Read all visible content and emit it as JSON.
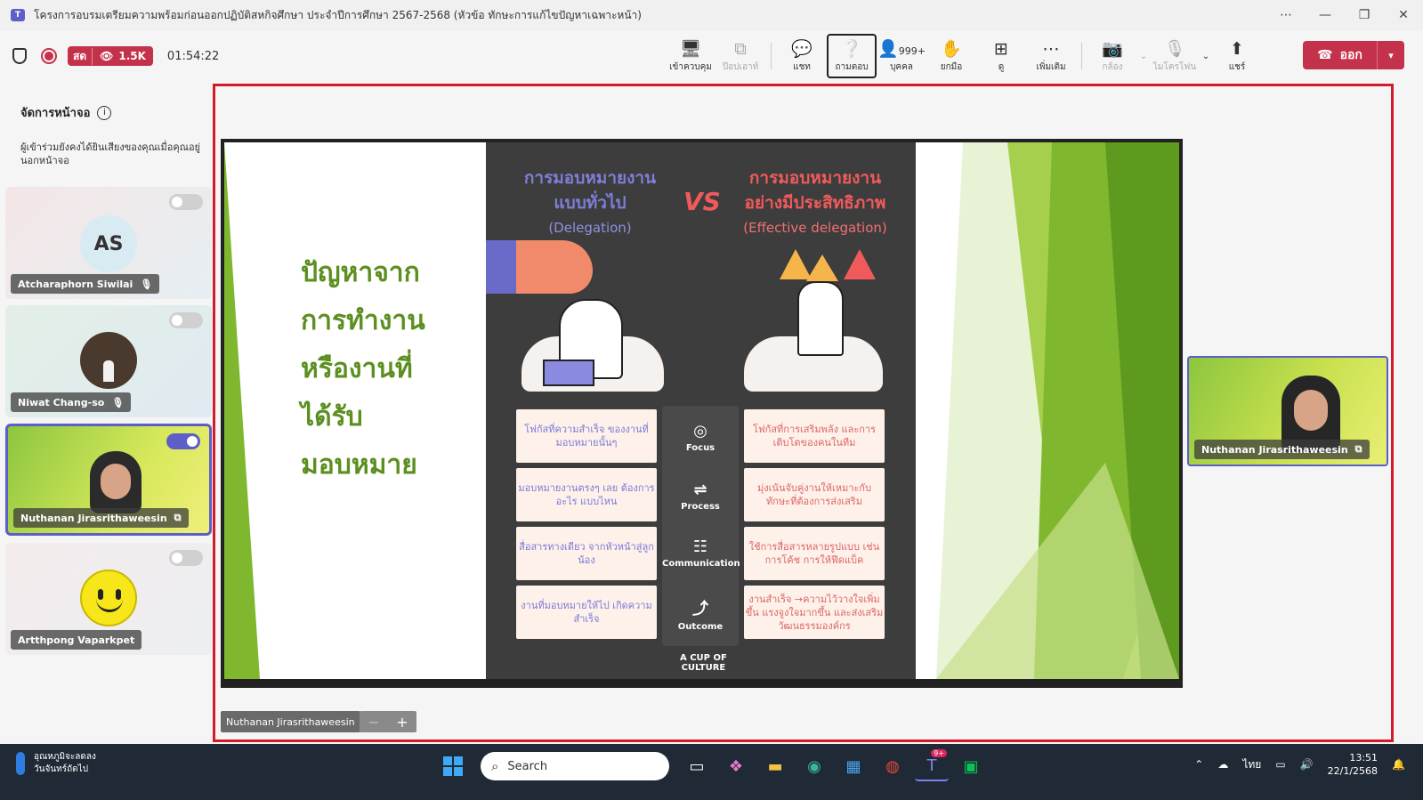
{
  "window": {
    "title": "โครงการอบรมเตรียมความพร้อมก่อนออกปฏิบัติสหกิจศึกษา ประจำปีการศึกษา 2567-2568 (หัวข้อ ทักษะการแก้ไขปัญหาเฉพาะหน้า)",
    "app_icon": "teams-icon"
  },
  "meeting": {
    "live_label": "สด",
    "viewers": "1.5K",
    "timer": "01:54:22",
    "tools": [
      {
        "label": "เข้าควบคุม",
        "icon": "take-control-icon"
      },
      {
        "label": "ป๊อปเอาท์",
        "icon": "popout-icon"
      },
      {
        "label": "แชท",
        "icon": "chat-icon"
      },
      {
        "label": "ถามตอบ",
        "icon": "qa-icon"
      },
      {
        "label": "บุคคล",
        "icon": "people-icon",
        "count": "999+"
      },
      {
        "label": "ยกมือ",
        "icon": "raise-hand-icon"
      },
      {
        "label": "ดู",
        "icon": "view-icon"
      },
      {
        "label": "เพิ่มเติม",
        "icon": "more-icon"
      },
      {
        "label": "กล้อง",
        "icon": "camera-off-icon"
      },
      {
        "label": "ไมโครโฟน",
        "icon": "mic-off-icon"
      },
      {
        "label": "แชร์",
        "icon": "share-icon"
      }
    ],
    "leave_label": "ออก"
  },
  "sidebar": {
    "title": "จัดการหน้าจอ",
    "description": "ผู้เข้าร่วมยังคงได้ยินเสียงของคุณเมื่อคุณอยู่นอกหน้าจอ",
    "participants": [
      {
        "name": "Atcharaphorn Siwilai",
        "initials": "AS",
        "on_stage": false
      },
      {
        "name": "Niwat Chang-so",
        "on_stage": false
      },
      {
        "name": "Nuthanan Jirasrithaweesin",
        "on_stage": true
      },
      {
        "name": "Artthpong Vaparkpet",
        "on_stage": false
      }
    ]
  },
  "stage": {
    "presenter_name": "Nuthanan Jirasrithaweesin",
    "zoom_minus": "−",
    "zoom_plus": "+",
    "slide": {
      "title": "ปัญหาจาก การทำงาน หรืองานที่ ได้รับ มอบหมาย",
      "title_lines": [
        "ปัญหาจาก",
        "การทำงาน",
        "หรืองานที่",
        "ได้รับ",
        "มอบหมาย"
      ],
      "infographic": {
        "left_heading_1": "การมอบหมายงาน",
        "left_heading_2": "แบบทั่วไป",
        "left_sub": "(Delegation)",
        "right_heading_1": "การมอบหมายงาน",
        "right_heading_2": "อย่างมีประสิทธิภาพ",
        "right_sub": "(Effective delegation)",
        "vs": "VS",
        "rows": [
          {
            "left": "โฟกัสที่ความสำเร็จ ของงานที่มอบหมายนั้นๆ",
            "middle": "Focus",
            "right": "โฟกัสที่การเสริมพลัง และการเติบโตของคนในทีม"
          },
          {
            "left": "มอบหมายงานตรงๆ เลย ต้องการอะไร แบบไหน",
            "middle": "Process",
            "right": "มุ่งเน้นจับคู่งานให้เหมาะกับ ทักษะที่ต้องการส่งเสริม"
          },
          {
            "left": "สื่อสารทางเดียว จากหัวหน้าสู่ลูกน้อง",
            "middle": "Communication",
            "right": "ใช้การสื่อสารหลายรูปแบบ เช่น การโค้ช การให้ฟีดแบ็ค"
          },
          {
            "left": "งานที่มอบหมายให้ไป เกิดความสำเร็จ",
            "middle": "Outcome",
            "right": "งานสำเร็จ →ความไว้วางใจเพิ่มขึ้น แรงจูงใจมากขึ้น และส่งเสริมวัฒนธรรมองค์กร"
          }
        ],
        "footer_1": "A CUP OF",
        "footer_2": "CULTURE"
      }
    }
  },
  "right_tile": {
    "name": "Nuthanan Jirasrithaweesin"
  },
  "taskbar": {
    "weather_line1": "อุณหภูมิจะลดลง",
    "weather_line2": "วันจันทร์ถัดไป",
    "search_placeholder": "Search",
    "teams_badge": "9+",
    "language": "ไทย",
    "time": "13:51",
    "date": "22/1/2568"
  },
  "colors": {
    "accent": "#5b5fc7",
    "leave": "#c4314b",
    "stage_border": "#d21a2b",
    "slide_green": "#7fb82e"
  }
}
